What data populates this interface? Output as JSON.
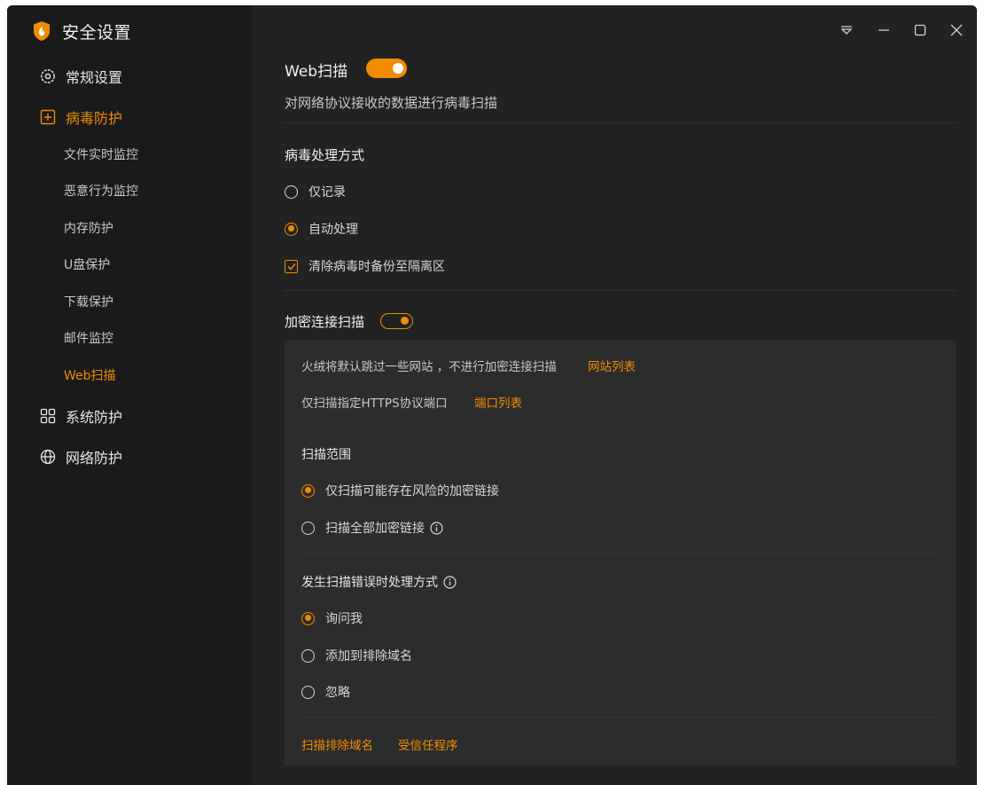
{
  "app": {
    "title": "安全设置"
  },
  "sidebar": {
    "items": [
      {
        "label": "常规设置"
      },
      {
        "label": "病毒防护"
      },
      {
        "label": "系统防护"
      },
      {
        "label": "网络防护"
      }
    ],
    "sub_items": [
      {
        "label": "文件实时监控"
      },
      {
        "label": "恶意行为监控"
      },
      {
        "label": "内存防护"
      },
      {
        "label": "U盘保护"
      },
      {
        "label": "下载保护"
      },
      {
        "label": "邮件监控"
      },
      {
        "label": "Web扫描"
      }
    ]
  },
  "main": {
    "title": "Web扫描",
    "toggle_on": true,
    "description": "对网络协议接收的数据进行病毒扫描",
    "handling": {
      "title": "病毒处理方式",
      "options": [
        {
          "label": "仅记录",
          "checked": false
        },
        {
          "label": "自动处理",
          "checked": true
        }
      ],
      "backup_label": "清除病毒时备份至隔离区",
      "backup_checked": true
    },
    "encrypted": {
      "title": "加密连接扫描",
      "toggle_on": true,
      "skip_text": "火绒将默认跳过一些网站 ，不进行加密连接扫描",
      "site_list_link": "网站列表",
      "https_text": "仅扫描指定HTTPS协议端口",
      "port_list_link": "端口列表",
      "scope_title": "扫描范围",
      "scope_options": [
        {
          "label": "仅扫描可能存在风险的加密链接",
          "checked": true
        },
        {
          "label": "扫描全部加密链接",
          "checked": false
        }
      ],
      "error_title": "发生扫描错误时处理方式",
      "error_options": [
        {
          "label": "询问我",
          "checked": true
        },
        {
          "label": "添加到排除域名",
          "checked": false
        },
        {
          "label": "忽略",
          "checked": false
        }
      ],
      "footer_links": [
        "扫描排除域名",
        "受信任程序"
      ]
    }
  },
  "colors": {
    "accent": "#f08c00",
    "bg": "#222222",
    "sidebar_bg": "#1a1a1a",
    "panel_bg": "#2c2c2c"
  }
}
